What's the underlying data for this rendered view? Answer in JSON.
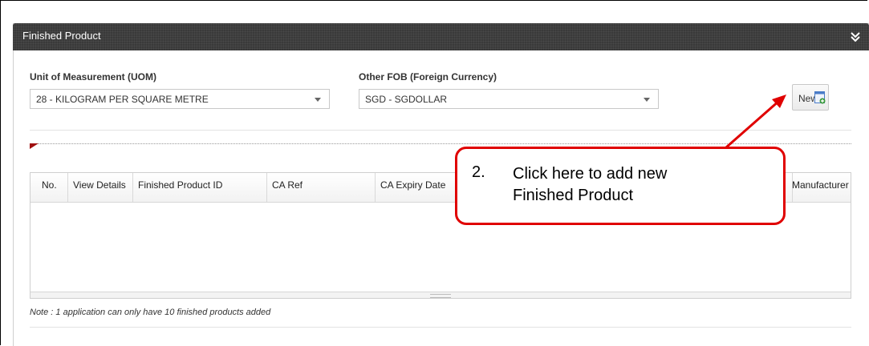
{
  "panel": {
    "title": "Finished Product"
  },
  "uom": {
    "label": "Unit of Measurement (UOM)",
    "value": "28 - KILOGRAM PER SQUARE METRE"
  },
  "fob": {
    "label": "Other FOB (Foreign Currency)",
    "value": "SGD - SGDOLLAR"
  },
  "new_button": {
    "label": "New"
  },
  "table": {
    "columns": [
      "No.",
      "View Details",
      "Finished Product ID",
      "CA Ref",
      "CA Expiry Date",
      "Manufacturer"
    ],
    "rows": []
  },
  "note": "Note : 1 application can only have 10 finished products added",
  "callout": {
    "number": "2.",
    "line1": "Click here to add new",
    "line2": "Finished Product"
  },
  "colors": {
    "header_bg": "#3a3a3a",
    "callout_red": "#e00000",
    "flag_red": "#a01010"
  },
  "icons": [
    "double-chevron-down-icon",
    "add-document-icon",
    "dropdown-caret-icon"
  ]
}
